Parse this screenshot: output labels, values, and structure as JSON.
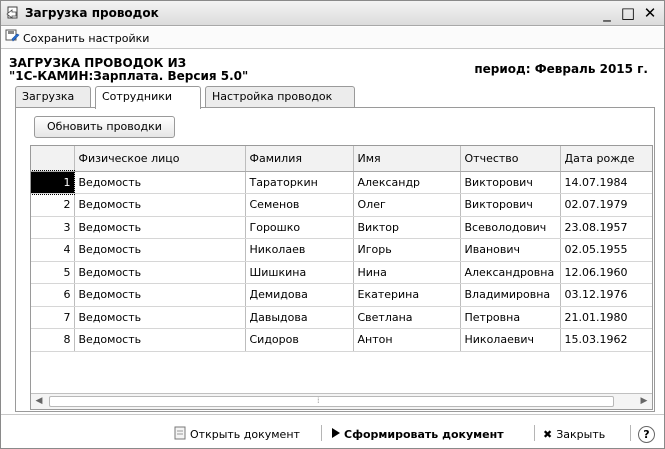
{
  "window": {
    "title": "Загрузка проводок",
    "minimize_glyph": "_",
    "maximize_glyph": "□",
    "close_glyph": "✕"
  },
  "toolbar": {
    "save_settings_label": "Сохранить настройки"
  },
  "header": {
    "title_line1": "ЗАГРУЗКА ПРОВОДОК ИЗ",
    "title_line2": "\"1С-КАМИН:Зарплата. Версия 5.0\"",
    "period": "период: Февраль 2015 г."
  },
  "tabs": [
    {
      "label": "Загрузка"
    },
    {
      "label": "Сотрудники"
    },
    {
      "label": "Настройка проводок"
    }
  ],
  "refresh_label": "Обновить проводки",
  "table": {
    "columns": [
      "",
      "Физическое лицо",
      "Фамилия",
      "Имя",
      "Отчество",
      "Дата рожде"
    ],
    "rows": [
      [
        "1",
        "Ведомость",
        "Тараторкин",
        "Александр",
        "Викторович",
        "14.07.1984"
      ],
      [
        "2",
        "Ведомость",
        "Семенов",
        "Олег",
        "Викторович",
        "02.07.1979"
      ],
      [
        "3",
        "Ведомость",
        "Горошко",
        "Виктор",
        "Всеволодович",
        "23.08.1957"
      ],
      [
        "4",
        "Ведомость",
        "Николаев",
        "Игорь",
        "Иванович",
        "02.05.1955"
      ],
      [
        "5",
        "Ведомость",
        "Шишкина",
        "Нина",
        "Александровна",
        "12.06.1960"
      ],
      [
        "6",
        "Ведомость",
        "Демидова",
        "Екатерина",
        "Владимировна",
        "03.12.1976"
      ],
      [
        "7",
        "Ведомость",
        "Давыдова",
        "Светлана",
        "Петровна",
        "21.01.1980"
      ],
      [
        "8",
        "Ведомость",
        "Сидоров",
        "Антон",
        "Николаевич",
        "15.03.1962"
      ]
    ],
    "selected_row": 1
  },
  "bottom": {
    "open_doc_label": "Открыть документ",
    "generate_label": "Сформировать документ",
    "close_label": "Закрыть",
    "help_glyph": "?"
  },
  "colors": {
    "selection": "#000000",
    "window_border": "#8a8a8a"
  }
}
